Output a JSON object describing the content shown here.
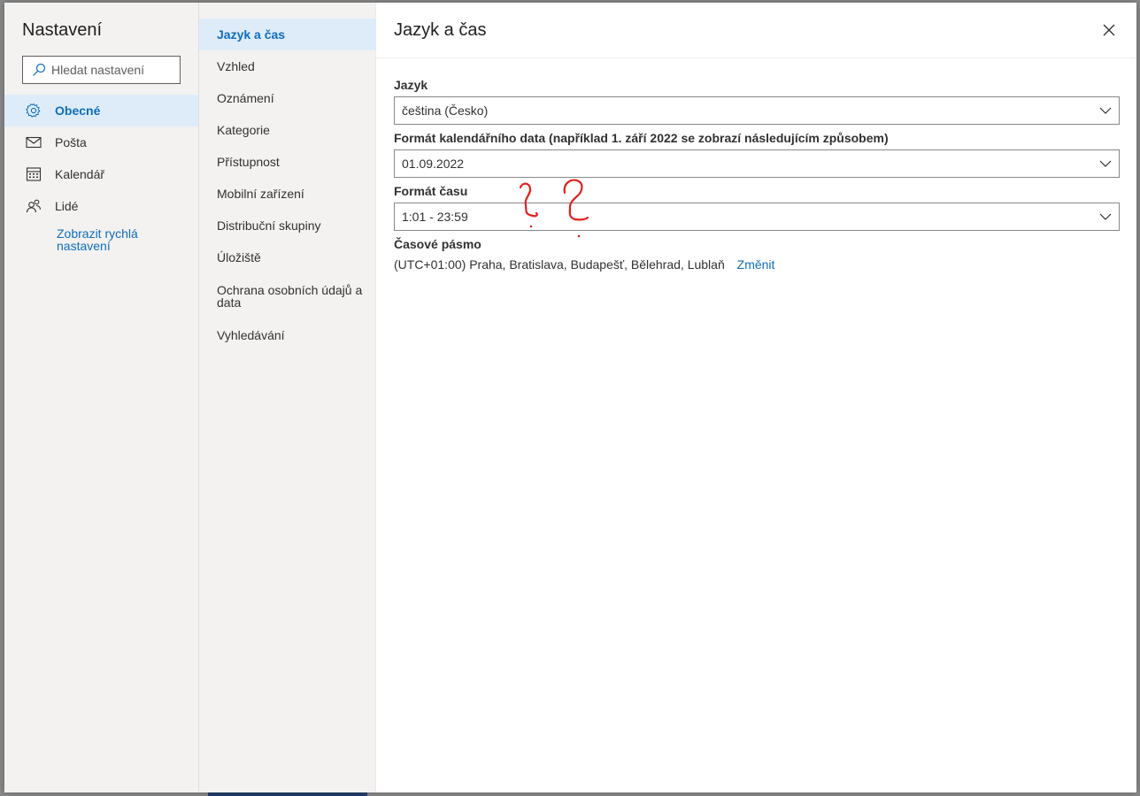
{
  "sidebar": {
    "title": "Nastavení",
    "search_placeholder": "Hledat nastavení",
    "items": [
      {
        "label": "Obecné",
        "icon": "gear-icon",
        "active": true
      },
      {
        "label": "Pošta",
        "icon": "mail-icon",
        "active": false
      },
      {
        "label": "Kalendář",
        "icon": "calendar-icon",
        "active": false
      },
      {
        "label": "Lidé",
        "icon": "people-icon",
        "active": false
      }
    ],
    "quick_settings_link": "Zobrazit rychlá nastavení"
  },
  "subnav": {
    "items": [
      {
        "label": "Jazyk a čas",
        "active": true
      },
      {
        "label": "Vzhled"
      },
      {
        "label": "Oznámení"
      },
      {
        "label": "Kategorie"
      },
      {
        "label": "Přístupnost"
      },
      {
        "label": "Mobilní zařízení"
      },
      {
        "label": "Distribuční skupiny"
      },
      {
        "label": "Úložiště"
      },
      {
        "label": "Ochrana osobních údajů a data"
      },
      {
        "label": "Vyhledávání"
      }
    ]
  },
  "main": {
    "title": "Jazyk a čas",
    "language": {
      "label": "Jazyk",
      "value": "čeština (Česko)"
    },
    "date_format": {
      "label": "Formát kalendářního data (například 1. září 2022 se zobrazí následujícím způsobem)",
      "value": "01.09.2022"
    },
    "time_format": {
      "label": "Formát času",
      "value": "1:01 - 23:59"
    },
    "time_zone": {
      "label": "Časové pásmo",
      "value": "(UTC+01:00) Praha, Bratislava, Budapešť, Bělehrad, Lublaň",
      "change_link": "Změnit"
    }
  },
  "colors": {
    "accent": "#0f6cbd",
    "active_bg": "#deecf9",
    "annotation": "#e02020"
  }
}
